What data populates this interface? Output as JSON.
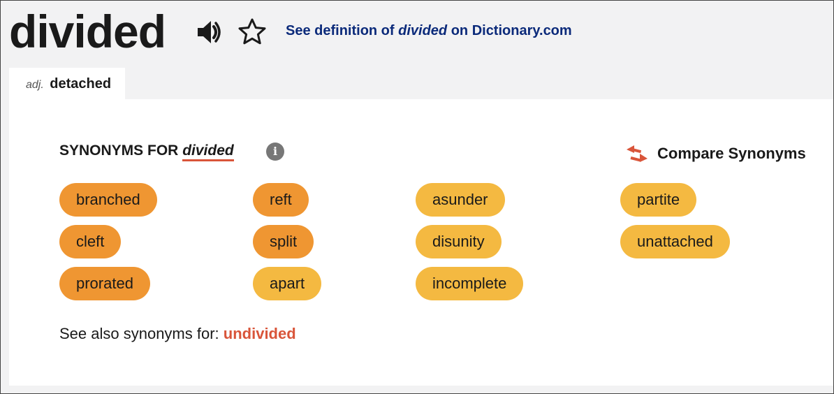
{
  "header": {
    "headword": "divided",
    "speaker_icon": "speaker-icon",
    "star_icon": "star-outline-icon",
    "definition_link": {
      "prefix": "See definition of ",
      "word": "divided",
      "suffix": " on Dictionary.com"
    }
  },
  "tab": {
    "pos": "adj.",
    "sense": "detached"
  },
  "synonyms": {
    "heading_prefix": "SYNONYMS FOR ",
    "heading_word": "divided",
    "info_icon": "info-icon",
    "info_glyph": "i",
    "compare_label": "Compare Synonyms",
    "compare_icon": "swap-arrows-icon",
    "colors": {
      "strong": "#ef9632",
      "medium": "#f4b941",
      "accent": "#d9553a",
      "link": "#0b2a7a"
    },
    "items": [
      {
        "label": "branched",
        "relevance": "strong"
      },
      {
        "label": "cleft",
        "relevance": "strong"
      },
      {
        "label": "prorated",
        "relevance": "strong"
      },
      {
        "label": "reft",
        "relevance": "strong"
      },
      {
        "label": "split",
        "relevance": "strong"
      },
      {
        "label": "apart",
        "relevance": "medium"
      },
      {
        "label": "asunder",
        "relevance": "medium"
      },
      {
        "label": "disunity",
        "relevance": "medium"
      },
      {
        "label": "incomplete",
        "relevance": "medium"
      },
      {
        "label": "partite",
        "relevance": "medium"
      },
      {
        "label": "unattached",
        "relevance": "medium"
      }
    ]
  },
  "see_also": {
    "prefix": "See also synonyms for: ",
    "link": "undivided"
  }
}
